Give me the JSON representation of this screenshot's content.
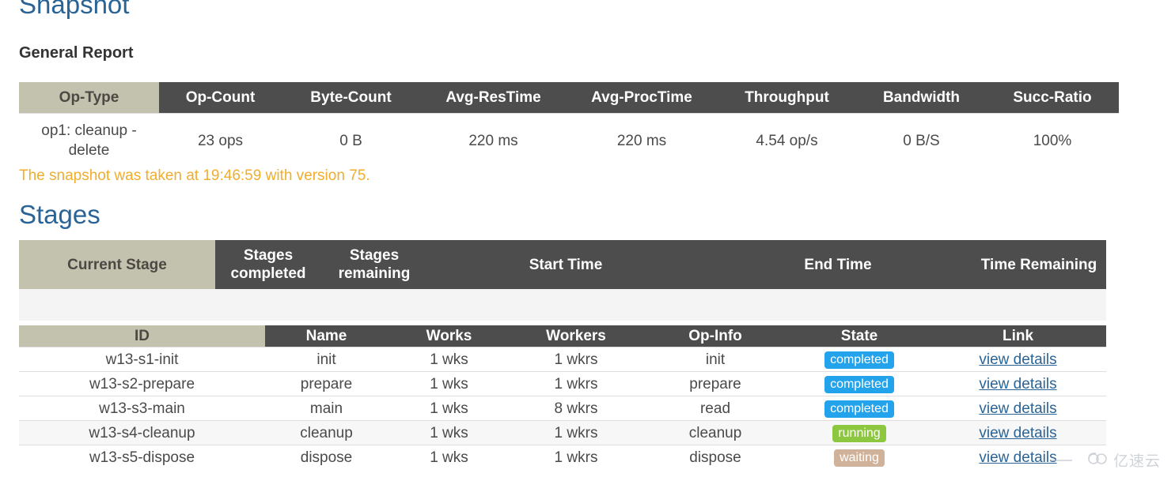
{
  "page": {
    "snapshot_title": "Snapshot",
    "general_report_title": "General Report",
    "snapshot_note": "The snapshot was taken at 19:46:59 with version 75.",
    "stages_title": "Stages"
  },
  "colors": {
    "heading_blue": "#2a6496",
    "note_orange": "#f0ad2e",
    "header_dark": "#4d4d4d",
    "header_khaki": "#c3c2ae",
    "badge_completed": "#22a3eb",
    "badge_running": "#8dc63f",
    "badge_waiting": "#cfb299",
    "link_blue": "#2a6496"
  },
  "report_table": {
    "columns": [
      "Op-Type",
      "Op-Count",
      "Byte-Count",
      "Avg-ResTime",
      "Avg-ProcTime",
      "Throughput",
      "Bandwidth",
      "Succ-Ratio"
    ],
    "rows": [
      {
        "op_type": "op1: cleanup - delete",
        "op_count": "23 ops",
        "byte_count": "0 B",
        "avg_restime": "220 ms",
        "avg_proctime": "220 ms",
        "throughput": "4.54 op/s",
        "bandwidth": "0 B/S",
        "succ_ratio": "100%"
      }
    ]
  },
  "stages_table": {
    "columns": [
      "Current Stage",
      "Stages completed",
      "Stages remaining",
      "Start Time",
      "End Time",
      "Time Remaining"
    ],
    "rows": [
      {
        "current_stage": "",
        "stages_completed": "",
        "stages_remaining": "",
        "start_time": "",
        "end_time": "",
        "time_remaining": ""
      }
    ]
  },
  "detail_table": {
    "columns": [
      "ID",
      "Name",
      "Works",
      "Workers",
      "Op-Info",
      "State",
      "Link"
    ],
    "link_label": "view details",
    "rows": [
      {
        "id": "w13-s1-init",
        "name": "init",
        "works": "1 wks",
        "workers": "1 wkrs",
        "op_info": "init",
        "state": "completed",
        "state_kind": "completed",
        "link": "view details"
      },
      {
        "id": "w13-s2-prepare",
        "name": "prepare",
        "works": "1 wks",
        "workers": "1 wkrs",
        "op_info": "prepare",
        "state": "completed",
        "state_kind": "completed",
        "link": "view details"
      },
      {
        "id": "w13-s3-main",
        "name": "main",
        "works": "1 wks",
        "workers": "8 wkrs",
        "op_info": "read",
        "state": "completed",
        "state_kind": "completed",
        "link": "view details"
      },
      {
        "id": "w13-s4-cleanup",
        "name": "cleanup",
        "works": "1 wks",
        "workers": "1 wkrs",
        "op_info": "cleanup",
        "state": "running",
        "state_kind": "running",
        "link": "view details"
      },
      {
        "id": "w13-s5-dispose",
        "name": "dispose",
        "works": "1 wks",
        "workers": "1 wkrs",
        "op_info": "dispose",
        "state": "waiting",
        "state_kind": "waiting",
        "link": "view details"
      }
    ]
  },
  "watermark": {
    "text": "亿速云",
    "icon": "cloud-icon"
  }
}
